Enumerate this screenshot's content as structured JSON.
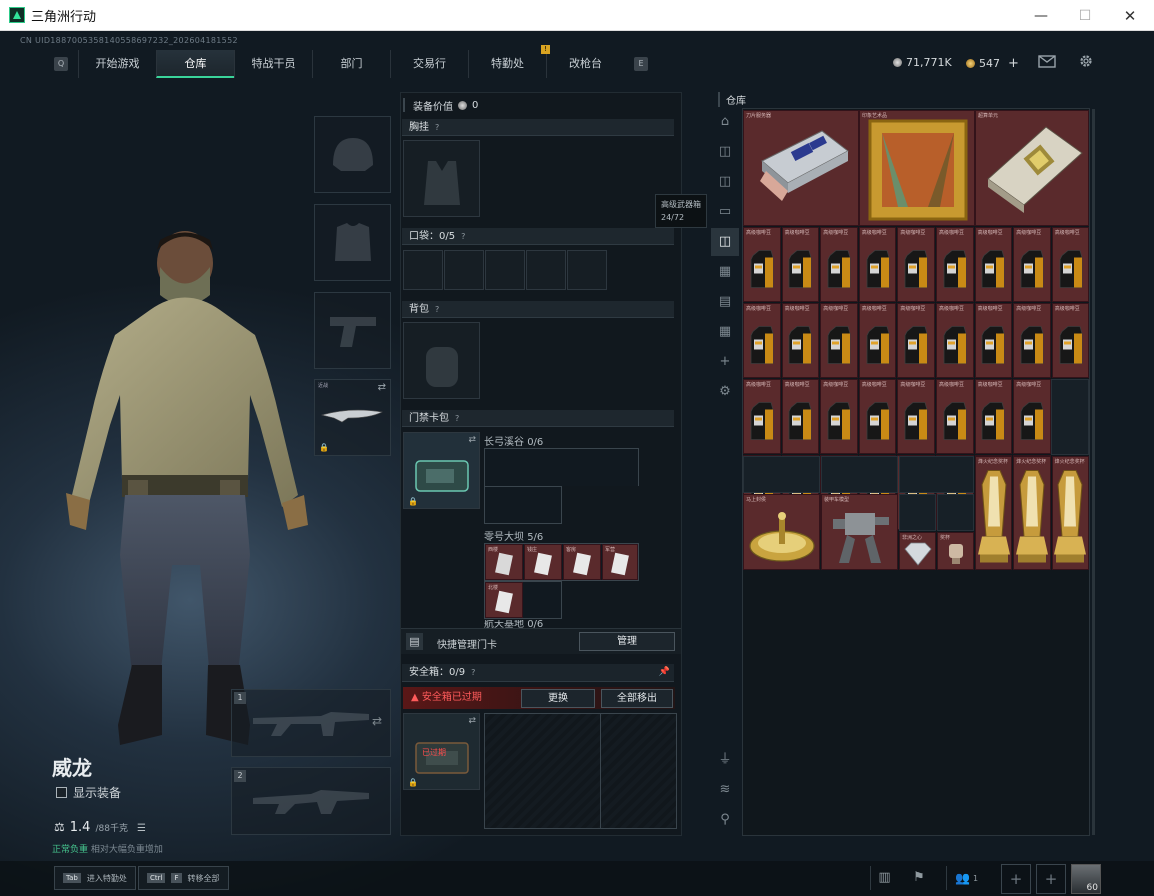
{
  "window": {
    "title": "三角洲行动",
    "minimize": "—",
    "maximize": "☐",
    "close": "✕"
  },
  "uid": "CN UID1887005358140558697232_202604181552",
  "nav": {
    "left_key": "Q",
    "right_key": "E",
    "tabs": [
      "开始游戏",
      "仓库",
      "特战干员",
      "部门",
      "交易行",
      "特勤处",
      "改枪台"
    ],
    "active_tab": "仓库",
    "alert_on": "改枪台",
    "alert_text": "!"
  },
  "currency": {
    "silver": "71,771K",
    "gold": "547",
    "gold_add": "+",
    "mail_icon": "mail-icon",
    "settings_icon": "gear-icon"
  },
  "character": {
    "name": "威龙",
    "show_gear": "显示装备",
    "weight": "1.4",
    "weight_max": "/88千克",
    "carry_hint_green": "正常负重",
    "carry_hint_rest": "  相对大幅负重增加"
  },
  "slots": {
    "melee_label": "近战",
    "weapon1_index": "1",
    "weapon2_index": "2"
  },
  "equipment": {
    "value_label": "装备价值",
    "value": "0",
    "rig_label": "胸挂",
    "pockets_label": "口袋：",
    "pockets_value": "0/5",
    "backpack_label": "背包",
    "keycard_label": "门禁卡包",
    "help_mark": "?",
    "keycard_groups": [
      {
        "name": "长弓溪谷",
        "count": "0/6"
      },
      {
        "name": "零号大坝",
        "count": "5/6"
      },
      {
        "name": "航天基地",
        "count": "0/6"
      }
    ],
    "keycard_item_labels": [
      "西楼",
      "钱庄",
      "客房",
      "军营",
      "北楼"
    ],
    "quick_manage": "快捷管理门卡",
    "manage_btn": "管理",
    "safe_box_label": "安全箱：",
    "safe_box_value": "0/9",
    "safe_expired": "安全箱已过期",
    "replace_btn": "更换",
    "move_all_btn": "全部移出",
    "expired_stamp": "已过期"
  },
  "tooltip": {
    "title": "高级武器箱",
    "count": "24/72"
  },
  "stash": {
    "title": "仓库",
    "top_items": [
      "刀片服务器",
      "印象艺术品",
      "超算单元"
    ],
    "coffee_label": "高级咖啡豆",
    "bottom_items": [
      "马上封侯",
      "非洲之心",
      "装甲车模型",
      "奖杯",
      "盘古",
      "烽火纪念奖杯",
      "烽火纪念奖杯",
      "烽火纪念奖杯"
    ]
  },
  "bottombar": {
    "tab_key": "Tab",
    "tab_text": "进入特勤处",
    "ctrl_key": "Ctrl",
    "f_key": "F",
    "ctrl_text": "转移全部",
    "friends_count": "1",
    "level": "60"
  }
}
